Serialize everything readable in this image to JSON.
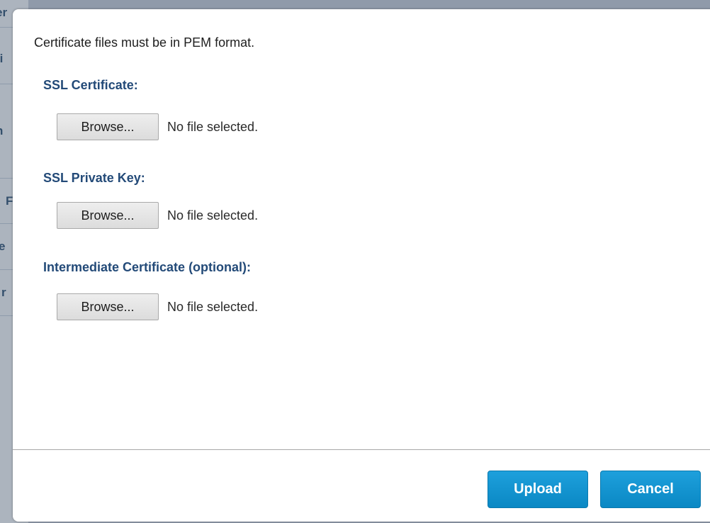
{
  "background": {
    "rows": [
      {
        "fragment": "er"
      },
      {
        "fragment": "fi"
      },
      {
        "fragment": "n"
      },
      {
        "fragment": "F"
      },
      {
        "fragment": "e"
      },
      {
        "fragment": "r"
      }
    ]
  },
  "dialog": {
    "intro": "Certificate files must be in PEM format.",
    "fields": [
      {
        "label": "SSL Certificate:",
        "button": "Browse...",
        "status": "No file selected."
      },
      {
        "label": "SSL Private Key:",
        "button": "Browse...",
        "status": "No file selected."
      },
      {
        "label": "Intermediate Certificate (optional):",
        "button": "Browse...",
        "status": "No file selected."
      }
    ],
    "actions": {
      "upload": "Upload",
      "cancel": "Cancel"
    }
  },
  "colors": {
    "label": "#234a78",
    "primary_button": "#1796d2",
    "overlay": "#8f9aaa"
  }
}
